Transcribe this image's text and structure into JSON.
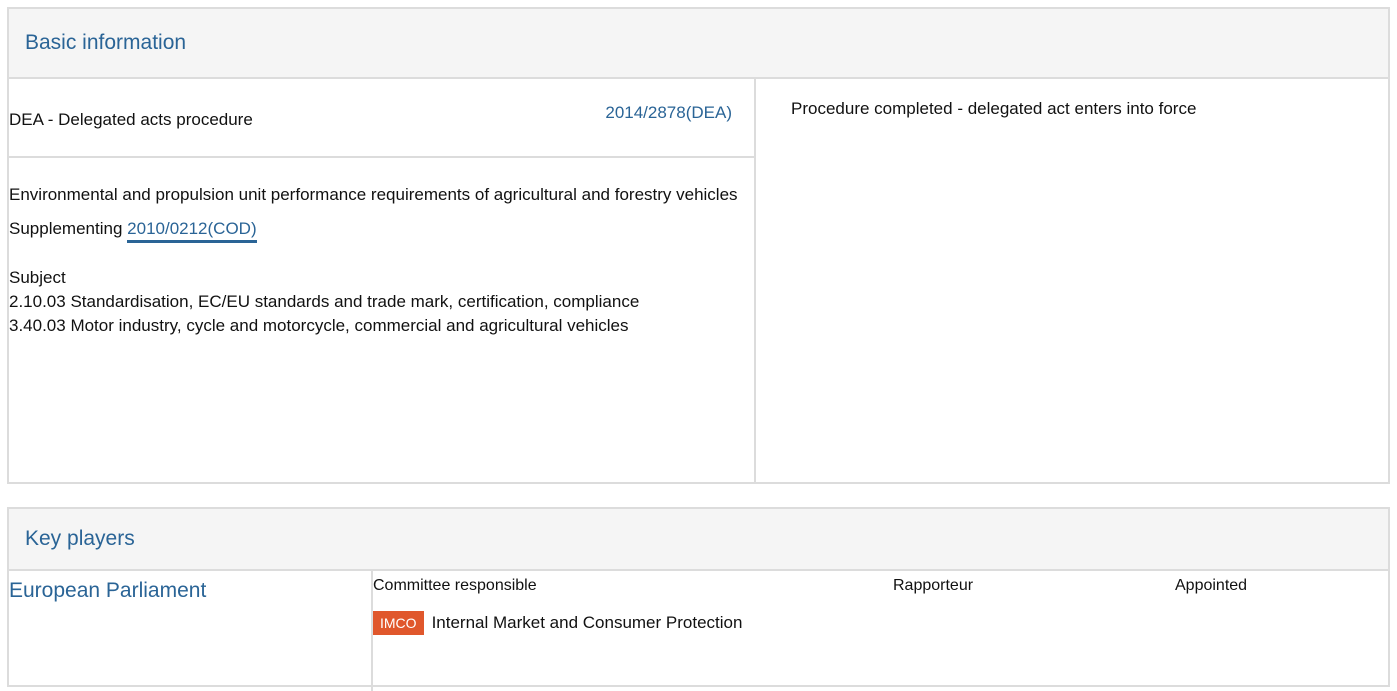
{
  "basic_information": {
    "title": "Basic information",
    "procedure_type": "DEA - Delegated acts procedure",
    "procedure_reference": "2014/2878(DEA)",
    "status": "Procedure completed - delegated act enters into force",
    "description": "Environmental and propulsion unit performance requirements of agricultural and forestry vehicles",
    "supplementing_label": "Supplementing",
    "supplementing_reference": "2010/0212(COD)",
    "subject_label": "Subject",
    "subjects": [
      "2.10.03 Standardisation, EC/EU standards and trade mark, certification, compliance",
      "3.40.03 Motor industry, cycle and motorcycle, commercial and agricultural vehicles"
    ]
  },
  "key_players": {
    "title": "Key players",
    "institution": "European Parliament",
    "column_headers": {
      "committee": "Committee responsible",
      "rapporteur": "Rapporteur",
      "appointed": "Appointed"
    },
    "committee": {
      "code": "IMCO",
      "name": "Internal Market and Consumer Protection",
      "badge_color": "#e0572c"
    }
  },
  "colors": {
    "link": "#2a6496",
    "border": "#dcdcdc",
    "header_bg": "#f5f5f5"
  }
}
